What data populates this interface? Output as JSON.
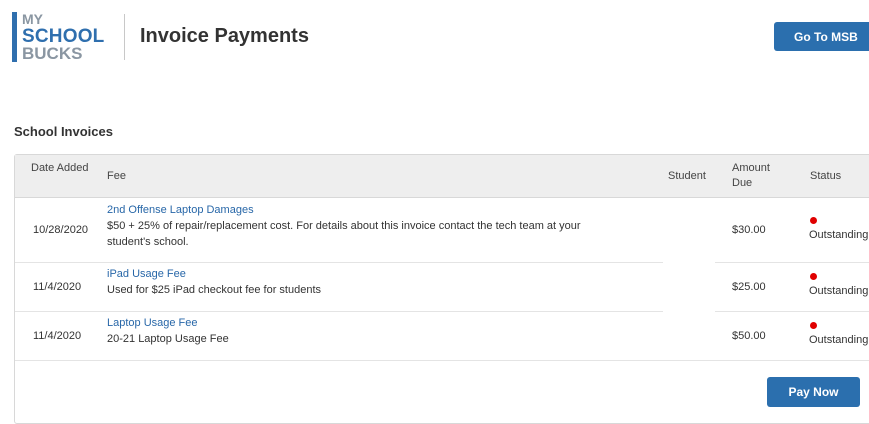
{
  "brand": {
    "logo_line1": "MY",
    "logo_line2": "SCHOOL",
    "logo_line3": "BUCKS",
    "accent_color": "#2b6fae",
    "status_color": "#e00000"
  },
  "header": {
    "title": "Invoice Payments",
    "goto_button": "Go To MSB"
  },
  "invoices": {
    "section_title": "School Invoices",
    "columns": {
      "date_added": "Date Added",
      "fee": "Fee",
      "student": "Student",
      "amount_due": "Amount Due",
      "status": "Status"
    },
    "rows": [
      {
        "date": "10/28/2020",
        "fee_name": "2nd Offense Laptop Damages",
        "fee_description": "$50 + 25% of repair/replacement cost. For details about this invoice contact the tech team at your student's school.",
        "student": "",
        "amount": "$30.00",
        "status": "Outstanding"
      },
      {
        "date": "11/4/2020",
        "fee_name": "iPad Usage Fee",
        "fee_description": "Used for $25 iPad checkout fee for students",
        "student": "",
        "amount": "$25.00",
        "status": "Outstanding"
      },
      {
        "date": "11/4/2020",
        "fee_name": "Laptop Usage Fee",
        "fee_description": "20-21 Laptop Usage Fee",
        "student": "",
        "amount": "$50.00",
        "status": "Outstanding"
      }
    ],
    "pay_button": "Pay Now"
  }
}
